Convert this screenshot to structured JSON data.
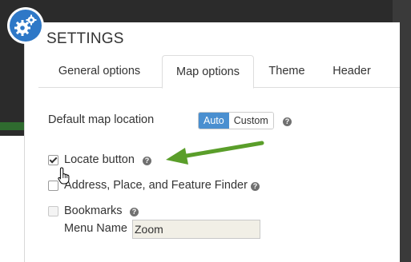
{
  "dialog": {
    "title": "SETTINGS",
    "icon": "gears-icon"
  },
  "tabs": [
    {
      "label": "General options",
      "active": false
    },
    {
      "label": "Map options",
      "active": true
    },
    {
      "label": "Theme",
      "active": false
    },
    {
      "label": "Header",
      "active": false
    }
  ],
  "map_location": {
    "label": "Default map location",
    "options": [
      "Auto",
      "Custom"
    ],
    "selected": "Auto",
    "help": "?"
  },
  "locate_button": {
    "label": "Locate button",
    "checked": true,
    "help": "?"
  },
  "finder": {
    "label": "Address, Place, and Feature Finder",
    "checked": false,
    "help": "?"
  },
  "bookmarks": {
    "label": "Bookmarks",
    "checked": false,
    "disabled": true,
    "help": "?",
    "menu_name_label": "Menu Name",
    "menu_name_value": "Zoom"
  },
  "colors": {
    "accent": "#4a8fd0",
    "badge": "#2e78c7",
    "annotation_arrow": "#5a9e2a"
  }
}
